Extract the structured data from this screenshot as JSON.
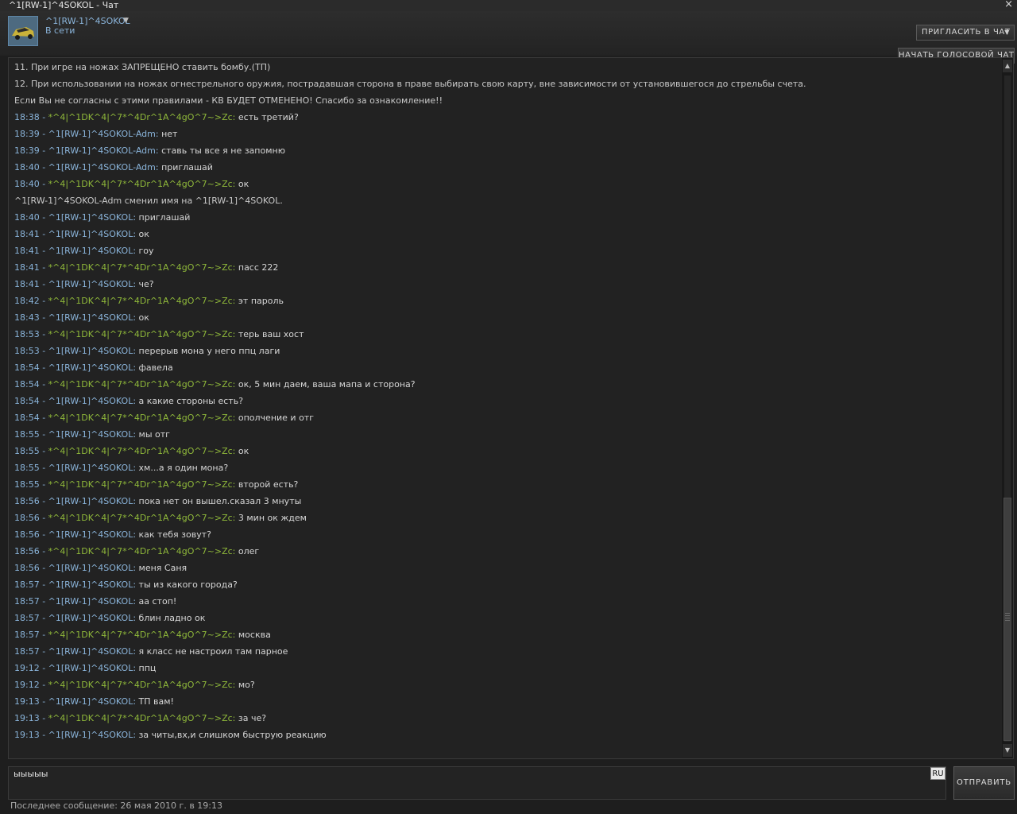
{
  "window": {
    "title": "^1[RW-1]^4SOKOL - Чат",
    "close_glyph": "×"
  },
  "user": {
    "name": "^1[RW-1]^4SOKOL",
    "status": "В сети",
    "avatar_icon": "car-avatar-icon",
    "dropdown_icon": "chevron-down-icon"
  },
  "buttons": {
    "invite": "ПРИГЛАСИТЬ В ЧАТ",
    "voice": "НАЧАТЬ ГОЛОСОВОЙ ЧАТ",
    "send": "ОТПРАВИТЬ"
  },
  "colors": {
    "self_name": "#8ab4da",
    "other_name": "#8fb83a",
    "timestamp": "#8ab4da"
  },
  "messages": [
    {
      "type": "system",
      "text": "11. При игре на ножах ЗАПРЕЩЕНО ставить бомбу.(ТП)"
    },
    {
      "type": "system",
      "text": "12. При использовании на ножах огнестрельного оружия, пострадавшая сторона в праве выбирать свою карту, вне зависимости от установившегося до стрельбы счета."
    },
    {
      "type": "system",
      "text": "Если Вы не согласны с этими правилами - КВ БУДЕТ ОТМЕНЕНО! Спасибо за ознакомление!!"
    },
    {
      "type": "chat",
      "time": "18:38",
      "sender": "*^4|^1DK^4|^7*^4Dr^1A^4gO^7~>Zc",
      "who": "other",
      "text": "есть третий?"
    },
    {
      "type": "chat",
      "time": "18:39",
      "sender": "^1[RW-1]^4SOKOL-Adm",
      "who": "self",
      "text": "нет"
    },
    {
      "type": "chat",
      "time": "18:39",
      "sender": "^1[RW-1]^4SOKOL-Adm",
      "who": "self",
      "text": "ставь ты все я не запомню"
    },
    {
      "type": "chat",
      "time": "18:40",
      "sender": "^1[RW-1]^4SOKOL-Adm",
      "who": "self",
      "text": "приглашай"
    },
    {
      "type": "chat",
      "time": "18:40",
      "sender": "*^4|^1DK^4|^7*^4Dr^1A^4gO^7~>Zc",
      "who": "other",
      "text": "ок"
    },
    {
      "type": "system",
      "text": "^1[RW-1]^4SOKOL-Adm сменил имя на ^1[RW-1]^4SOKOL."
    },
    {
      "type": "chat",
      "time": "18:40",
      "sender": "^1[RW-1]^4SOKOL",
      "who": "self",
      "text": "приглашай"
    },
    {
      "type": "chat",
      "time": "18:41",
      "sender": "^1[RW-1]^4SOKOL",
      "who": "self",
      "text": "ок"
    },
    {
      "type": "chat",
      "time": "18:41",
      "sender": "^1[RW-1]^4SOKOL",
      "who": "self",
      "text": "гоу"
    },
    {
      "type": "chat",
      "time": "18:41",
      "sender": "*^4|^1DK^4|^7*^4Dr^1A^4gO^7~>Zc",
      "who": "other",
      "text": "пасс 222"
    },
    {
      "type": "chat",
      "time": "18:41",
      "sender": "^1[RW-1]^4SOKOL",
      "who": "self",
      "text": "че?"
    },
    {
      "type": "chat",
      "time": "18:42",
      "sender": "*^4|^1DK^4|^7*^4Dr^1A^4gO^7~>Zc",
      "who": "other",
      "text": "эт пароль"
    },
    {
      "type": "chat",
      "time": "18:43",
      "sender": "^1[RW-1]^4SOKOL",
      "who": "self",
      "text": "ок"
    },
    {
      "type": "chat",
      "time": "18:53",
      "sender": "*^4|^1DK^4|^7*^4Dr^1A^4gO^7~>Zc",
      "who": "other",
      "text": "терь ваш хост"
    },
    {
      "type": "chat",
      "time": "18:53",
      "sender": "^1[RW-1]^4SOKOL",
      "who": "self",
      "text": "перерыв мона у него ппц лаги"
    },
    {
      "type": "chat",
      "time": "18:54",
      "sender": "^1[RW-1]^4SOKOL",
      "who": "self",
      "text": "фавела"
    },
    {
      "type": "chat",
      "time": "18:54",
      "sender": "*^4|^1DK^4|^7*^4Dr^1A^4gO^7~>Zc",
      "who": "other",
      "text": "ок, 5 мин даем, ваша мапа и сторона?"
    },
    {
      "type": "chat",
      "time": "18:54",
      "sender": "^1[RW-1]^4SOKOL",
      "who": "self",
      "text": "а какие стороны есть?"
    },
    {
      "type": "chat",
      "time": "18:54",
      "sender": "*^4|^1DK^4|^7*^4Dr^1A^4gO^7~>Zc",
      "who": "other",
      "text": "ополчение и отг"
    },
    {
      "type": "chat",
      "time": "18:55",
      "sender": "^1[RW-1]^4SOKOL",
      "who": "self",
      "text": "мы отг"
    },
    {
      "type": "chat",
      "time": "18:55",
      "sender": "*^4|^1DK^4|^7*^4Dr^1A^4gO^7~>Zc",
      "who": "other",
      "text": "ок"
    },
    {
      "type": "chat",
      "time": "18:55",
      "sender": "^1[RW-1]^4SOKOL",
      "who": "self",
      "text": "хм...а я один мона?"
    },
    {
      "type": "chat",
      "time": "18:55",
      "sender": "*^4|^1DK^4|^7*^4Dr^1A^4gO^7~>Zc",
      "who": "other",
      "text": "второй есть?"
    },
    {
      "type": "chat",
      "time": "18:56",
      "sender": "^1[RW-1]^4SOKOL",
      "who": "self",
      "text": "пока нет он вышел.сказал 3 мнуты"
    },
    {
      "type": "chat",
      "time": "18:56",
      "sender": "*^4|^1DK^4|^7*^4Dr^1A^4gO^7~>Zc",
      "who": "other",
      "text": "3 мин ок ждем"
    },
    {
      "type": "chat",
      "time": "18:56",
      "sender": "^1[RW-1]^4SOKOL",
      "who": "self",
      "text": "как тебя зовут?"
    },
    {
      "type": "chat",
      "time": "18:56",
      "sender": "*^4|^1DK^4|^7*^4Dr^1A^4gO^7~>Zc",
      "who": "other",
      "text": "олег"
    },
    {
      "type": "chat",
      "time": "18:56",
      "sender": "^1[RW-1]^4SOKOL",
      "who": "self",
      "text": "меня Саня"
    },
    {
      "type": "chat",
      "time": "18:57",
      "sender": "^1[RW-1]^4SOKOL",
      "who": "self",
      "text": "ты из какого города?"
    },
    {
      "type": "chat",
      "time": "18:57",
      "sender": "^1[RW-1]^4SOKOL",
      "who": "self",
      "text": "аа стоп!"
    },
    {
      "type": "chat",
      "time": "18:57",
      "sender": "^1[RW-1]^4SOKOL",
      "who": "self",
      "text": "блин ладно ок"
    },
    {
      "type": "chat",
      "time": "18:57",
      "sender": "*^4|^1DK^4|^7*^4Dr^1A^4gO^7~>Zc",
      "who": "other",
      "text": "москва"
    },
    {
      "type": "chat",
      "time": "18:57",
      "sender": "^1[RW-1]^4SOKOL",
      "who": "self",
      "text": "я класс не настроил там парное"
    },
    {
      "type": "chat",
      "time": "19:12",
      "sender": "^1[RW-1]^4SOKOL",
      "who": "self",
      "text": "ппц"
    },
    {
      "type": "chat",
      "time": "19:12",
      "sender": "*^4|^1DK^4|^7*^4Dr^1A^4gO^7~>Zc",
      "who": "other",
      "text": "мо?"
    },
    {
      "type": "chat",
      "time": "19:13",
      "sender": "^1[RW-1]^4SOKOL",
      "who": "self",
      "text": "ТП вам!"
    },
    {
      "type": "chat",
      "time": "19:13",
      "sender": "*^4|^1DK^4|^7*^4Dr^1A^4gO^7~>Zc",
      "who": "other",
      "text": "за че?"
    },
    {
      "type": "chat",
      "time": "19:13",
      "sender": "^1[RW-1]^4SOKOL",
      "who": "self",
      "text": "за читы,вх,и слишком быструю реакцию"
    }
  ],
  "scrollbar": {
    "up_icon": "arrow-up-icon",
    "down_icon": "arrow-down-icon",
    "position": 1.0
  },
  "input": {
    "value": "ыыыыы",
    "lang": "RU"
  },
  "footer": {
    "last_message": "Последнее сообщение: 26 мая 2010 г. в 19:13"
  }
}
